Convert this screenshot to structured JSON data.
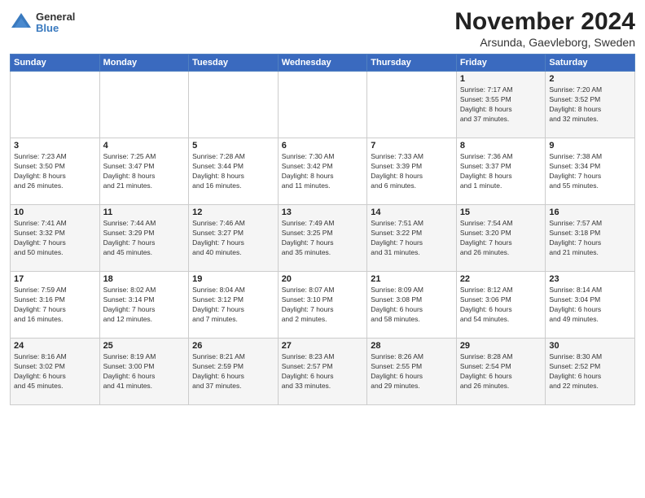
{
  "logo": {
    "line1": "General",
    "line2": "Blue"
  },
  "title": "November 2024",
  "subtitle": "Arsunda, Gaevleborg, Sweden",
  "headers": [
    "Sunday",
    "Monday",
    "Tuesday",
    "Wednesday",
    "Thursday",
    "Friday",
    "Saturday"
  ],
  "rows": [
    [
      {
        "day": "",
        "info": ""
      },
      {
        "day": "",
        "info": ""
      },
      {
        "day": "",
        "info": ""
      },
      {
        "day": "",
        "info": ""
      },
      {
        "day": "",
        "info": ""
      },
      {
        "day": "1",
        "info": "Sunrise: 7:17 AM\nSunset: 3:55 PM\nDaylight: 8 hours\nand 37 minutes."
      },
      {
        "day": "2",
        "info": "Sunrise: 7:20 AM\nSunset: 3:52 PM\nDaylight: 8 hours\nand 32 minutes."
      }
    ],
    [
      {
        "day": "3",
        "info": "Sunrise: 7:23 AM\nSunset: 3:50 PM\nDaylight: 8 hours\nand 26 minutes."
      },
      {
        "day": "4",
        "info": "Sunrise: 7:25 AM\nSunset: 3:47 PM\nDaylight: 8 hours\nand 21 minutes."
      },
      {
        "day": "5",
        "info": "Sunrise: 7:28 AM\nSunset: 3:44 PM\nDaylight: 8 hours\nand 16 minutes."
      },
      {
        "day": "6",
        "info": "Sunrise: 7:30 AM\nSunset: 3:42 PM\nDaylight: 8 hours\nand 11 minutes."
      },
      {
        "day": "7",
        "info": "Sunrise: 7:33 AM\nSunset: 3:39 PM\nDaylight: 8 hours\nand 6 minutes."
      },
      {
        "day": "8",
        "info": "Sunrise: 7:36 AM\nSunset: 3:37 PM\nDaylight: 8 hours\nand 1 minute."
      },
      {
        "day": "9",
        "info": "Sunrise: 7:38 AM\nSunset: 3:34 PM\nDaylight: 7 hours\nand 55 minutes."
      }
    ],
    [
      {
        "day": "10",
        "info": "Sunrise: 7:41 AM\nSunset: 3:32 PM\nDaylight: 7 hours\nand 50 minutes."
      },
      {
        "day": "11",
        "info": "Sunrise: 7:44 AM\nSunset: 3:29 PM\nDaylight: 7 hours\nand 45 minutes."
      },
      {
        "day": "12",
        "info": "Sunrise: 7:46 AM\nSunset: 3:27 PM\nDaylight: 7 hours\nand 40 minutes."
      },
      {
        "day": "13",
        "info": "Sunrise: 7:49 AM\nSunset: 3:25 PM\nDaylight: 7 hours\nand 35 minutes."
      },
      {
        "day": "14",
        "info": "Sunrise: 7:51 AM\nSunset: 3:22 PM\nDaylight: 7 hours\nand 31 minutes."
      },
      {
        "day": "15",
        "info": "Sunrise: 7:54 AM\nSunset: 3:20 PM\nDaylight: 7 hours\nand 26 minutes."
      },
      {
        "day": "16",
        "info": "Sunrise: 7:57 AM\nSunset: 3:18 PM\nDaylight: 7 hours\nand 21 minutes."
      }
    ],
    [
      {
        "day": "17",
        "info": "Sunrise: 7:59 AM\nSunset: 3:16 PM\nDaylight: 7 hours\nand 16 minutes."
      },
      {
        "day": "18",
        "info": "Sunrise: 8:02 AM\nSunset: 3:14 PM\nDaylight: 7 hours\nand 12 minutes."
      },
      {
        "day": "19",
        "info": "Sunrise: 8:04 AM\nSunset: 3:12 PM\nDaylight: 7 hours\nand 7 minutes."
      },
      {
        "day": "20",
        "info": "Sunrise: 8:07 AM\nSunset: 3:10 PM\nDaylight: 7 hours\nand 2 minutes."
      },
      {
        "day": "21",
        "info": "Sunrise: 8:09 AM\nSunset: 3:08 PM\nDaylight: 6 hours\nand 58 minutes."
      },
      {
        "day": "22",
        "info": "Sunrise: 8:12 AM\nSunset: 3:06 PM\nDaylight: 6 hours\nand 54 minutes."
      },
      {
        "day": "23",
        "info": "Sunrise: 8:14 AM\nSunset: 3:04 PM\nDaylight: 6 hours\nand 49 minutes."
      }
    ],
    [
      {
        "day": "24",
        "info": "Sunrise: 8:16 AM\nSunset: 3:02 PM\nDaylight: 6 hours\nand 45 minutes."
      },
      {
        "day": "25",
        "info": "Sunrise: 8:19 AM\nSunset: 3:00 PM\nDaylight: 6 hours\nand 41 minutes."
      },
      {
        "day": "26",
        "info": "Sunrise: 8:21 AM\nSunset: 2:59 PM\nDaylight: 6 hours\nand 37 minutes."
      },
      {
        "day": "27",
        "info": "Sunrise: 8:23 AM\nSunset: 2:57 PM\nDaylight: 6 hours\nand 33 minutes."
      },
      {
        "day": "28",
        "info": "Sunrise: 8:26 AM\nSunset: 2:55 PM\nDaylight: 6 hours\nand 29 minutes."
      },
      {
        "day": "29",
        "info": "Sunrise: 8:28 AM\nSunset: 2:54 PM\nDaylight: 6 hours\nand 26 minutes."
      },
      {
        "day": "30",
        "info": "Sunrise: 8:30 AM\nSunset: 2:52 PM\nDaylight: 6 hours\nand 22 minutes."
      }
    ]
  ]
}
